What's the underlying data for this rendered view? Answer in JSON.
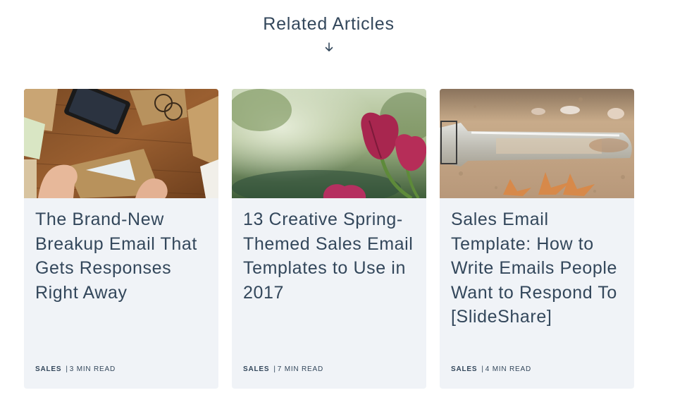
{
  "section": {
    "title": "Related Articles",
    "arrow_icon": "arrow-down-icon"
  },
  "articles": [
    {
      "title": "The Brand-New Breakup Email That Gets Responses Right Away",
      "category": "SALES",
      "separator": "|",
      "read_time": "3 MIN READ",
      "image": "photo of hands opening an envelope on a wooden desk with phone and glasses"
    },
    {
      "title": "13 Creative Spring-Themed Sales Email Templates to Use in 2017",
      "category": "SALES",
      "separator": "|",
      "read_time": "7 MIN READ",
      "image": "photo of pink tulips against a blurred green background"
    },
    {
      "title": "Sales Email Template: How to Write Emails People Want to Respond To [SlideShare]",
      "category": "SALES",
      "separator": "|",
      "read_time": "4 MIN READ",
      "image": "photo of a message in a glass bottle on sand with starfish"
    }
  ],
  "colors": {
    "text": "#33475b",
    "card_background": "#f0f3f7",
    "page_background": "#ffffff"
  }
}
